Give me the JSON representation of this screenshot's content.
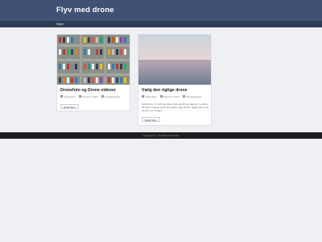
{
  "site": {
    "title": "Flyv med drone",
    "nav": {
      "home": "Hjem"
    }
  },
  "posts": [
    {
      "title": "Dronefoto og Drone videoer",
      "author": "webmaster",
      "date": "februar 6, 2017",
      "category": "Uncategorized",
      "excerpt": "",
      "read_more": "Read More"
    },
    {
      "title": "Vælg den rigtige drone",
      "author": "webmaster",
      "date": "februar 6, 2017",
      "category": "Uncategorized",
      "excerpt": "Køb drone: Vi stod lige bliver hvis det så har valgt en ny drone så skal vi hjælpe til din dronekøb, sagt på den rigtige drone der passer som bruger.",
      "read_more": "Read More"
    }
  ],
  "footer": {
    "copyright": "Copyright © | All Rights Reserved"
  },
  "colors": {
    "header": "#3f5273",
    "nav": "#2e3d57",
    "page_bg": "#eef0f4",
    "footer": "#1e1e1e"
  }
}
